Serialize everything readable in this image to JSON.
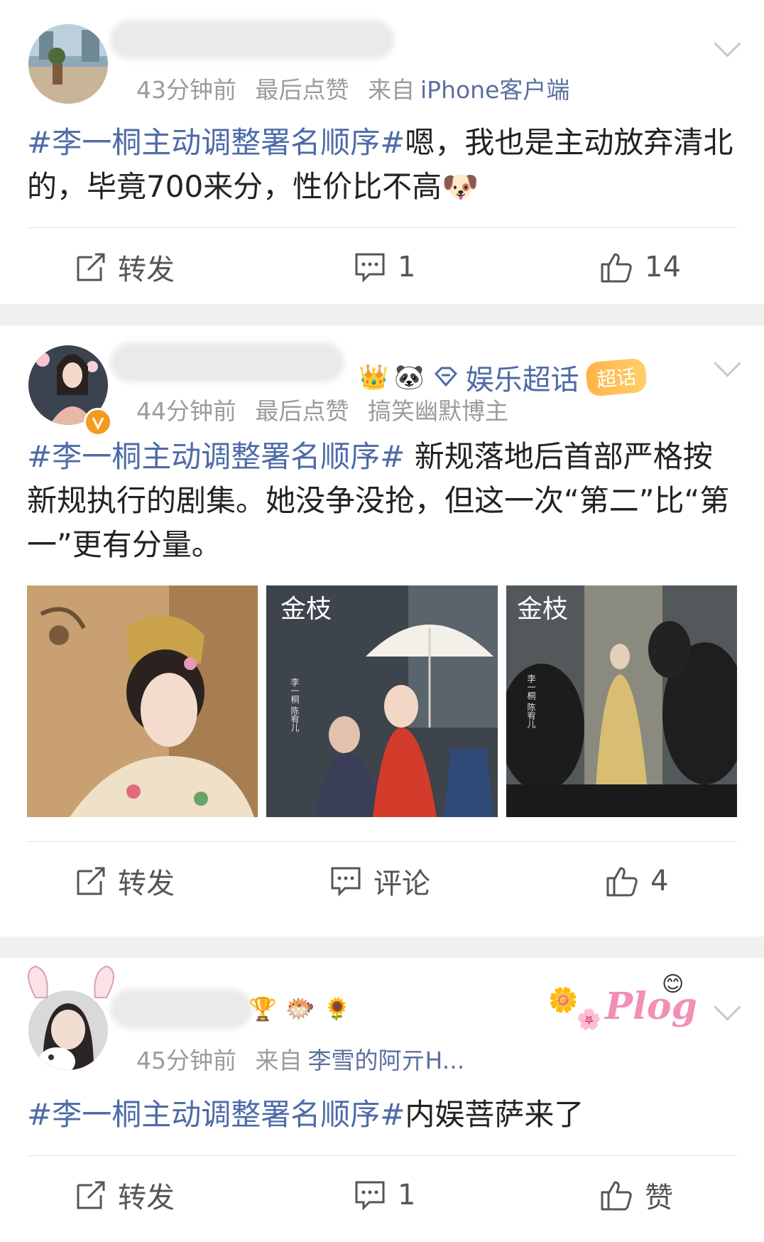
{
  "posts": [
    {
      "time": "43分钟前",
      "liked": "最后点赞",
      "source_prefix": "来自",
      "source": "iPhone客户端",
      "hashtag": "#李一桐主动调整署名顺序#",
      "text": "嗯，我也是主动放弃清北的，毕竟700来分，性价比不高",
      "emoji": "🐶",
      "actions": {
        "repost": "转发",
        "comment": "1",
        "like": "14"
      }
    },
    {
      "time": "44分钟前",
      "liked": "最后点赞",
      "source": "搞笑幽默博主",
      "topic": "娱乐超话",
      "super_badge": "超话",
      "hashtag": "#李一桐主动调整署名顺序#",
      "text": "新规落地后首部严格按新规执行的剧集。她没争没抢，但这一次“第二”比“第一”更有分量。",
      "images": [
        {
          "kind": "portrait"
        },
        {
          "kind": "poster",
          "title": "金枝",
          "credit": "李一桐 陈宥儿"
        },
        {
          "kind": "poster",
          "title": "金枝",
          "credit": "李一桐 陈宥儿"
        }
      ],
      "actions": {
        "repost": "转发",
        "comment": "评论",
        "like": "4"
      }
    },
    {
      "time": "45分钟前",
      "source_prefix": "来自",
      "source": "李雪的阿亓H...",
      "sticker": "Plog",
      "hashtag": "#李一桐主动调整署名顺序#",
      "text": "内娱菩萨来了",
      "actions": {
        "repost": "转发",
        "comment": "1",
        "like": "赞"
      }
    }
  ],
  "colors": {
    "link": "#4d6ba8",
    "meta": "#9b9b9b",
    "divider": "#f0f0f0"
  }
}
